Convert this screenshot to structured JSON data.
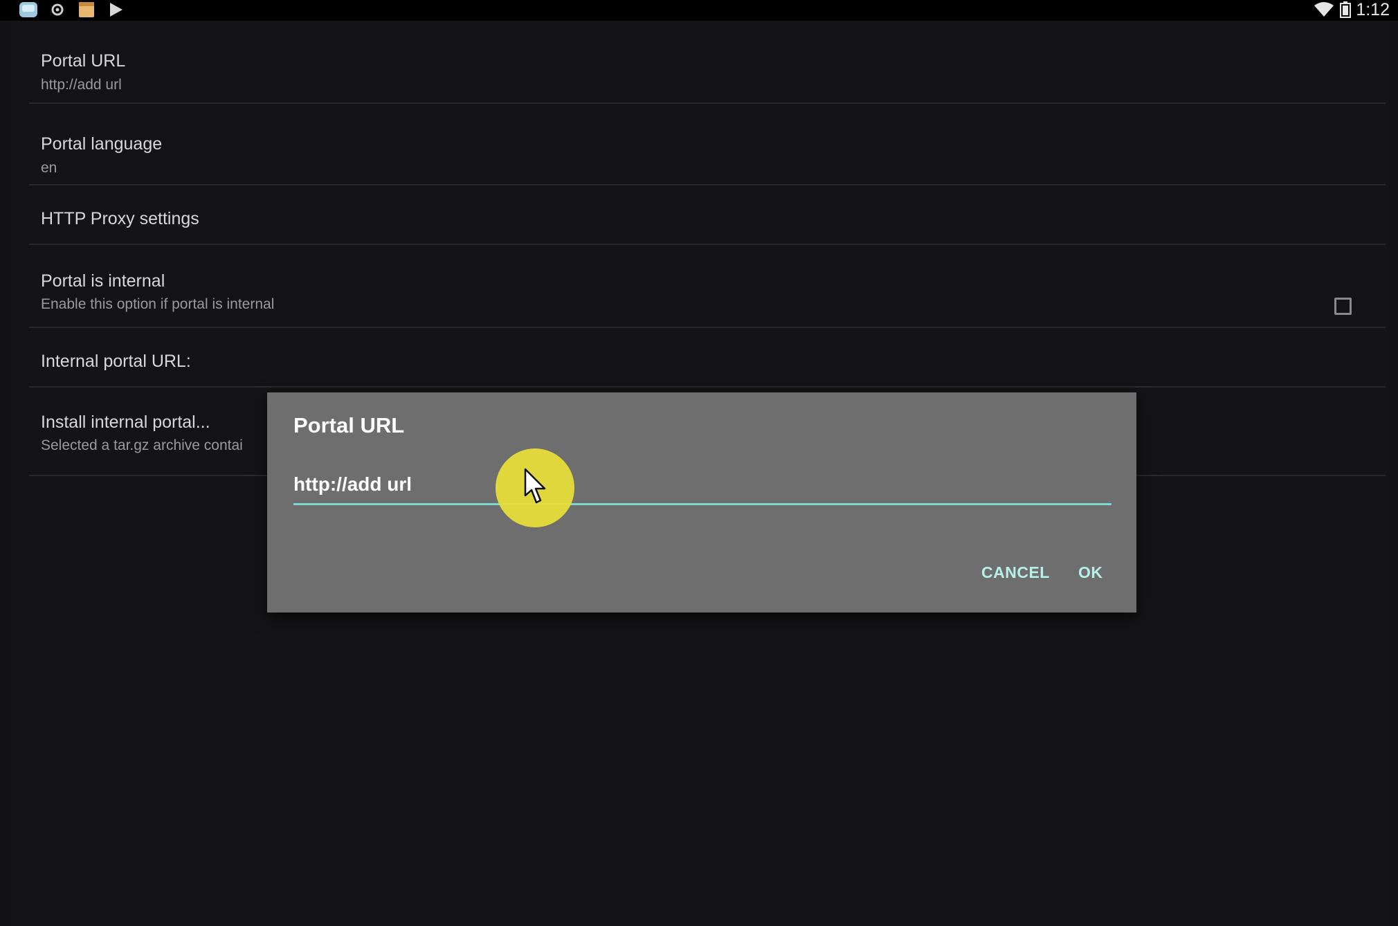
{
  "status_bar": {
    "left_icons": [
      "app-drawer-icon",
      "settings-icon",
      "notes-icon",
      "play-store-icon"
    ],
    "right_icons": [
      "wifi-icon",
      "battery-icon"
    ],
    "time": "1:12"
  },
  "settings": {
    "items": [
      {
        "title": "Portal URL",
        "summary": "http://add url"
      },
      {
        "title": "Portal language",
        "summary": "en"
      },
      {
        "title": "HTTP Proxy settings",
        "summary": ""
      },
      {
        "title": "Portal is internal",
        "summary": "Enable this option if portal is internal",
        "checked": false
      },
      {
        "title": "Internal portal URL:",
        "summary": ""
      },
      {
        "title": "Install internal portal...",
        "summary": "Selected a tar.gz archive contai"
      }
    ]
  },
  "dialog": {
    "title": "Portal URL",
    "input_value": "http://add url",
    "cancel_label": "CANCEL",
    "ok_label": "OK"
  },
  "colors": {
    "background": "#121214",
    "dialog_background": "#6e6e6e",
    "accent": "#7fd6cc",
    "click_highlight": "#e6dc3a"
  }
}
